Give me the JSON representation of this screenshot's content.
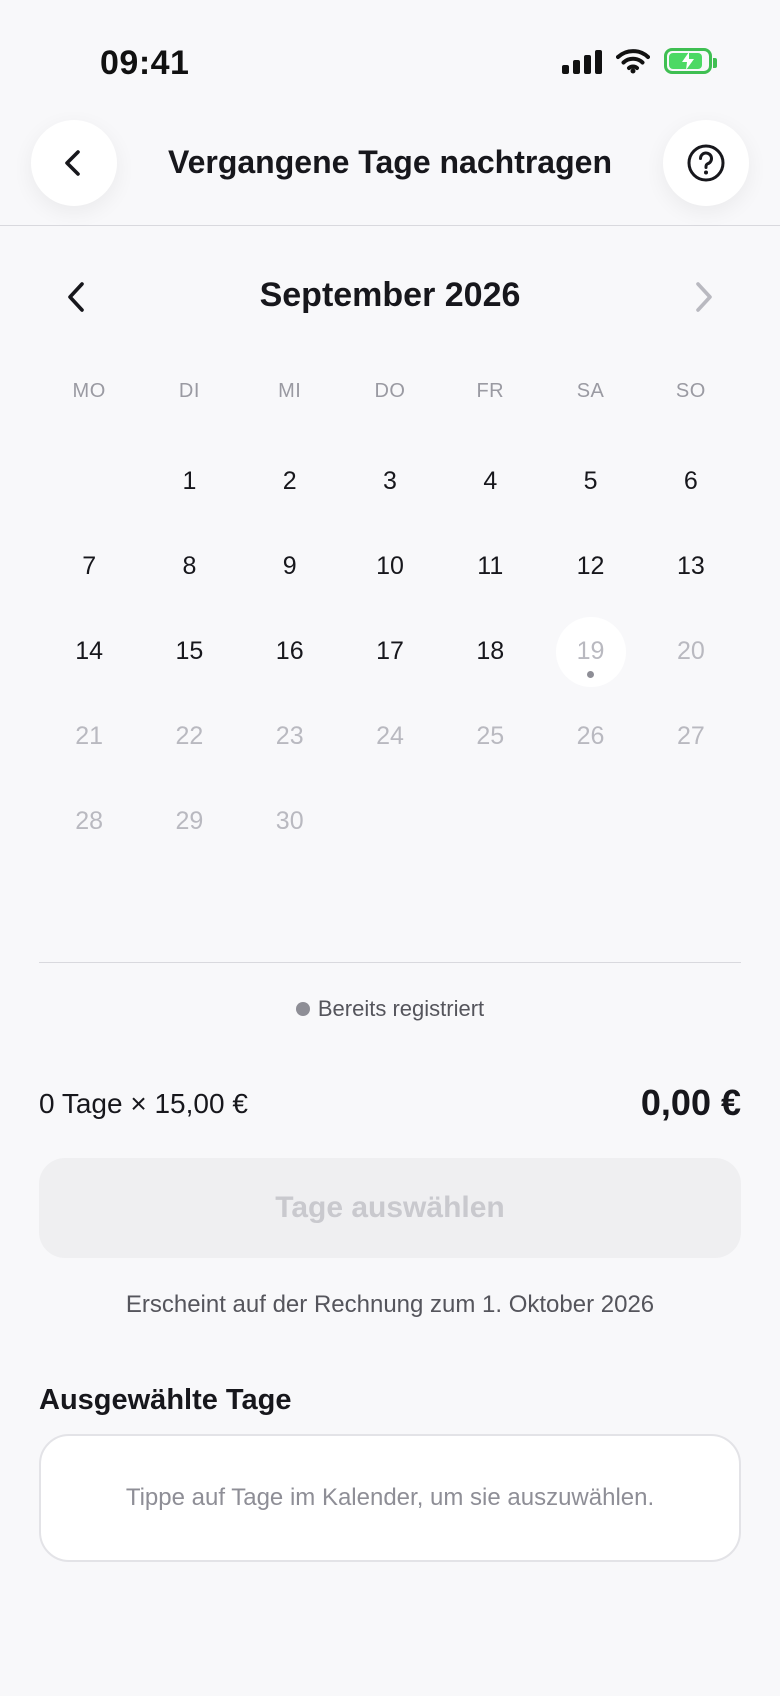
{
  "status_bar": {
    "time": "09:41",
    "icons": [
      "signal-icon",
      "wifi-icon",
      "battery-charging-icon"
    ],
    "battery_color": "#4cd964"
  },
  "header": {
    "title": "Vergangene Tage nachtragen",
    "back_icon": "chevron-left-icon",
    "help_icon": "question-circle-icon"
  },
  "calendar": {
    "month_label": "September 2026",
    "weekdays": [
      "MO",
      "DI",
      "MI",
      "DO",
      "FR",
      "SA",
      "SO"
    ],
    "leading_empty": 1,
    "days": [
      {
        "n": "1",
        "state": "available"
      },
      {
        "n": "2",
        "state": "available"
      },
      {
        "n": "3",
        "state": "available"
      },
      {
        "n": "4",
        "state": "available"
      },
      {
        "n": "5",
        "state": "available"
      },
      {
        "n": "6",
        "state": "available"
      },
      {
        "n": "7",
        "state": "available"
      },
      {
        "n": "8",
        "state": "available"
      },
      {
        "n": "9",
        "state": "available"
      },
      {
        "n": "10",
        "state": "available"
      },
      {
        "n": "11",
        "state": "available"
      },
      {
        "n": "12",
        "state": "available"
      },
      {
        "n": "13",
        "state": "available"
      },
      {
        "n": "14",
        "state": "available"
      },
      {
        "n": "15",
        "state": "available"
      },
      {
        "n": "16",
        "state": "available"
      },
      {
        "n": "17",
        "state": "available"
      },
      {
        "n": "18",
        "state": "available"
      },
      {
        "n": "19",
        "state": "today-registered"
      },
      {
        "n": "20",
        "state": "disabled"
      },
      {
        "n": "21",
        "state": "disabled"
      },
      {
        "n": "22",
        "state": "disabled"
      },
      {
        "n": "23",
        "state": "disabled"
      },
      {
        "n": "24",
        "state": "disabled"
      },
      {
        "n": "25",
        "state": "disabled"
      },
      {
        "n": "26",
        "state": "disabled"
      },
      {
        "n": "27",
        "state": "disabled"
      },
      {
        "n": "28",
        "state": "disabled"
      },
      {
        "n": "29",
        "state": "disabled"
      },
      {
        "n": "30",
        "state": "disabled"
      }
    ]
  },
  "legend": {
    "label": "Bereits registriert",
    "dot_color": "#8e8e96"
  },
  "summary": {
    "calculation": "0 Tage × 15,00 €",
    "total": "0,00 €"
  },
  "action": {
    "button_label": "Tage auswählen",
    "invoice_note": "Erscheint auf der Rechnung zum 1. Oktober 2026"
  },
  "selected_days": {
    "title": "Ausgewählte Tage",
    "empty_hint": "Tippe auf Tage im Kalender, um sie auszuwählen."
  }
}
